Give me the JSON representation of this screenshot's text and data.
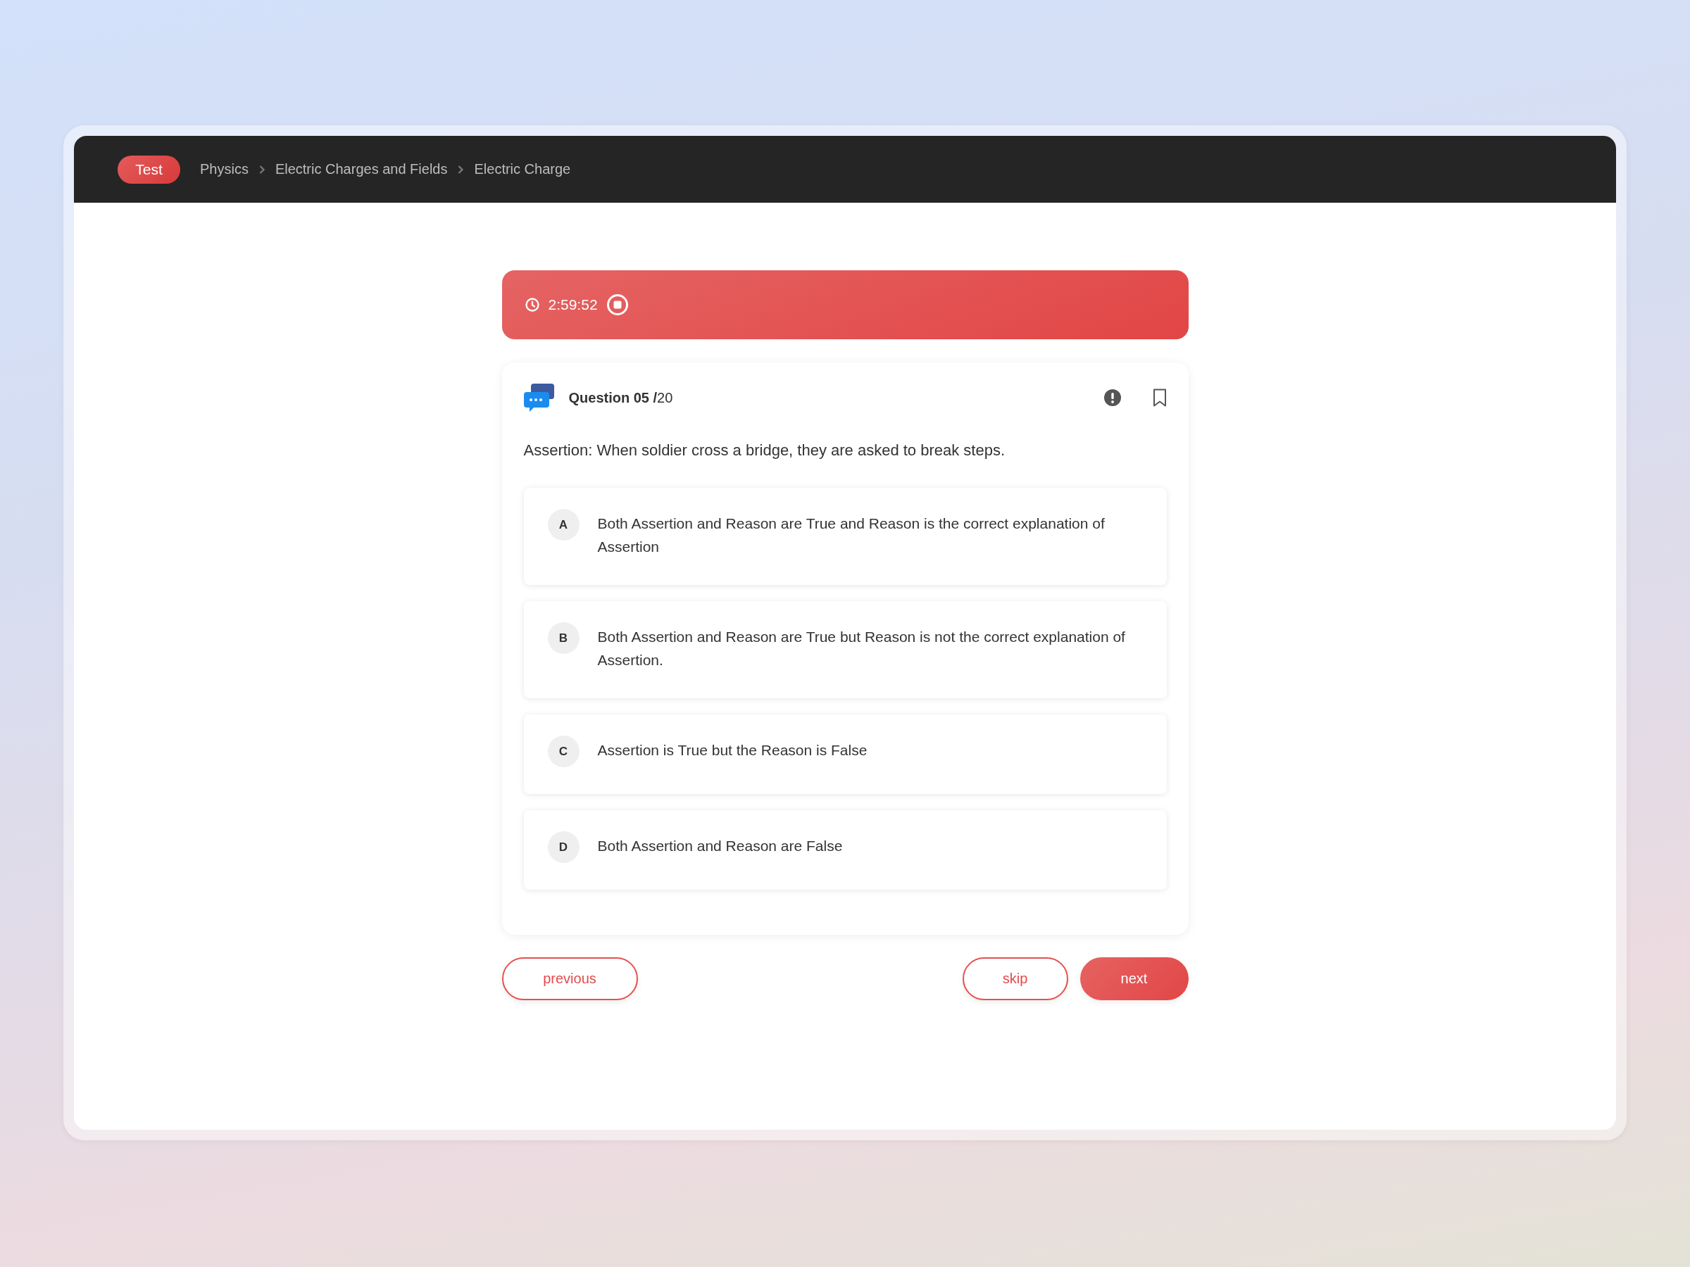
{
  "header": {
    "badge": "Test",
    "breadcrumb": [
      "Physics",
      "Electric Charges and Fields",
      "Electric Charge"
    ]
  },
  "timer": {
    "time": "2:59:52"
  },
  "question": {
    "title": "**Question 05 /**20",
    "text": "Assertion: When soldier cross a bridge, they are asked to break steps.",
    "options": [
      {
        "letter": "A",
        "text": "Both Assertion and Reason are True and Reason is the correct explanation of Assertion"
      },
      {
        "letter": "B",
        "text": "Both Assertion and Reason are True but Reason is not the correct explanation of Assertion."
      },
      {
        "letter": "C",
        "text": "Assertion is True but the Reason is False"
      },
      {
        "letter": "D",
        "text": "Both Assertion and Reason are False"
      }
    ]
  },
  "buttons": [
    {
      "label": "previous",
      "kind": "outline"
    },
    {
      "label": "skip",
      "kind": "outline"
    },
    {
      "label": "next",
      "kind": "filled"
    }
  ]
}
